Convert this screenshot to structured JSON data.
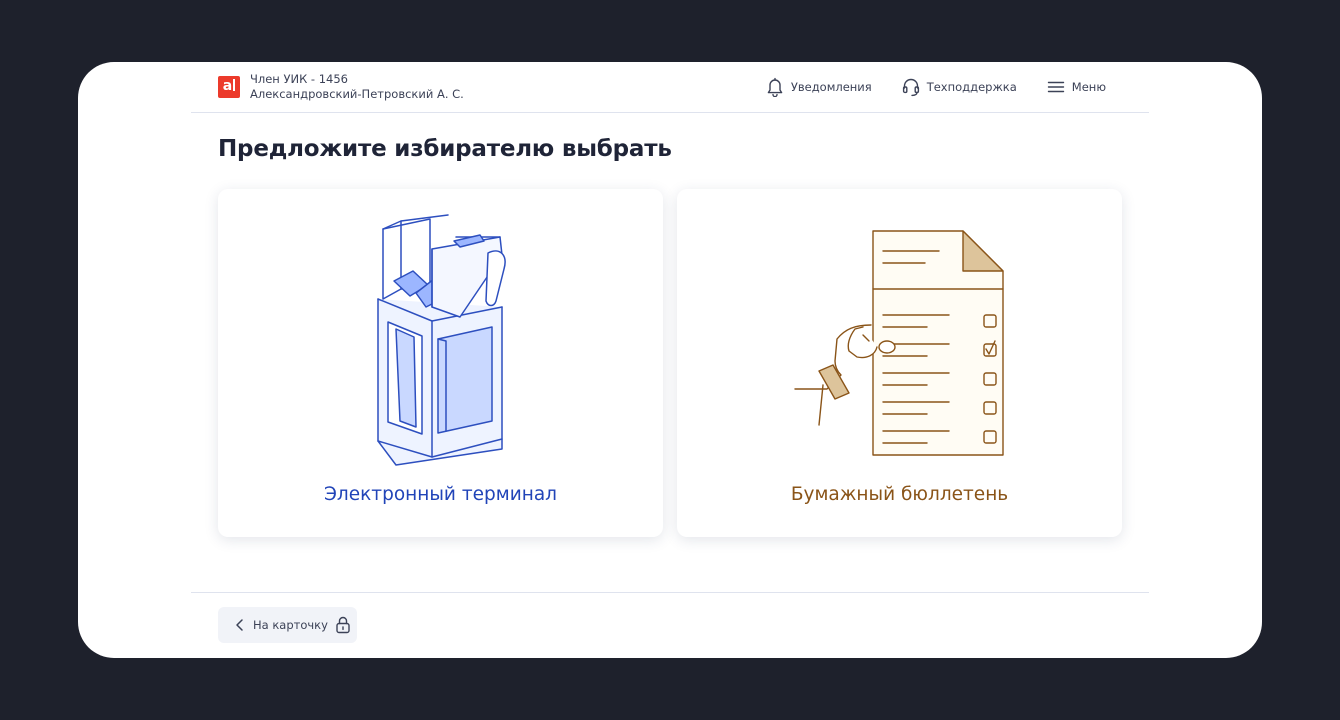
{
  "header": {
    "logo_text": "a",
    "user_role": "Член УИК - 1456",
    "user_name": "Александровский-Петровский А. С.",
    "nav": {
      "notifications": "Уведомления",
      "support": "Техподдержка",
      "menu": "Меню"
    }
  },
  "main": {
    "title": "Предложите избирателю выбрать",
    "options": [
      {
        "label": "Электронный терминал",
        "color": "#2144b8"
      },
      {
        "label": "Бумажный бюллетень",
        "color": "#8a5418"
      }
    ]
  },
  "footer": {
    "back_label": "На карточку"
  },
  "colors": {
    "background": "#1e212c",
    "logo": "#ec3a2b",
    "terminal_accent": "#2144b8",
    "ballot_accent": "#8a5418"
  }
}
